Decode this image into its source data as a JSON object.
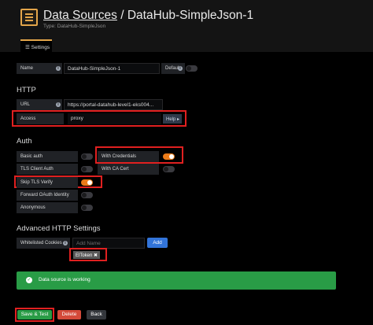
{
  "header": {
    "title_link": "Data Sources",
    "title_rest": " / DataHub-SimpleJson-1",
    "subtitle": "Type: DataHub-SimpleJson",
    "tab_label": "Settings"
  },
  "form": {
    "name_label": "Name",
    "name_value": "DataHub-SimpleJson-1",
    "default_label": "Default"
  },
  "http": {
    "heading": "HTTP",
    "url_label": "URL",
    "url_value": "https://portal-datahub-level1-eks004...",
    "access_label": "Access",
    "access_value": "proxy",
    "help_label": "Help ▸"
  },
  "auth": {
    "heading": "Auth",
    "basic": "Basic auth",
    "tls_client": "TLS Client Auth",
    "skip_tls": "Skip TLS Verify",
    "forward_oauth": "Forward OAuth Identity",
    "anonymous": "Anonymous",
    "with_credentials": "With Credentials",
    "with_ca_cert": "With CA Cert"
  },
  "advanced": {
    "heading": "Advanced HTTP Settings",
    "cookies_label": "Whitelisted Cookies",
    "add_name_placeholder": "Add Name",
    "add_button": "Add",
    "token": "ElToken ✖"
  },
  "alert": {
    "text": "Data source is working"
  },
  "buttons": {
    "save": "Save & Test",
    "delete": "Delete",
    "back": "Back"
  },
  "colors": {
    "accent": "#eb7b18",
    "success": "#299c46",
    "danger": "#d44a3a",
    "primary": "#3274d9",
    "highlight": "#e02020"
  }
}
